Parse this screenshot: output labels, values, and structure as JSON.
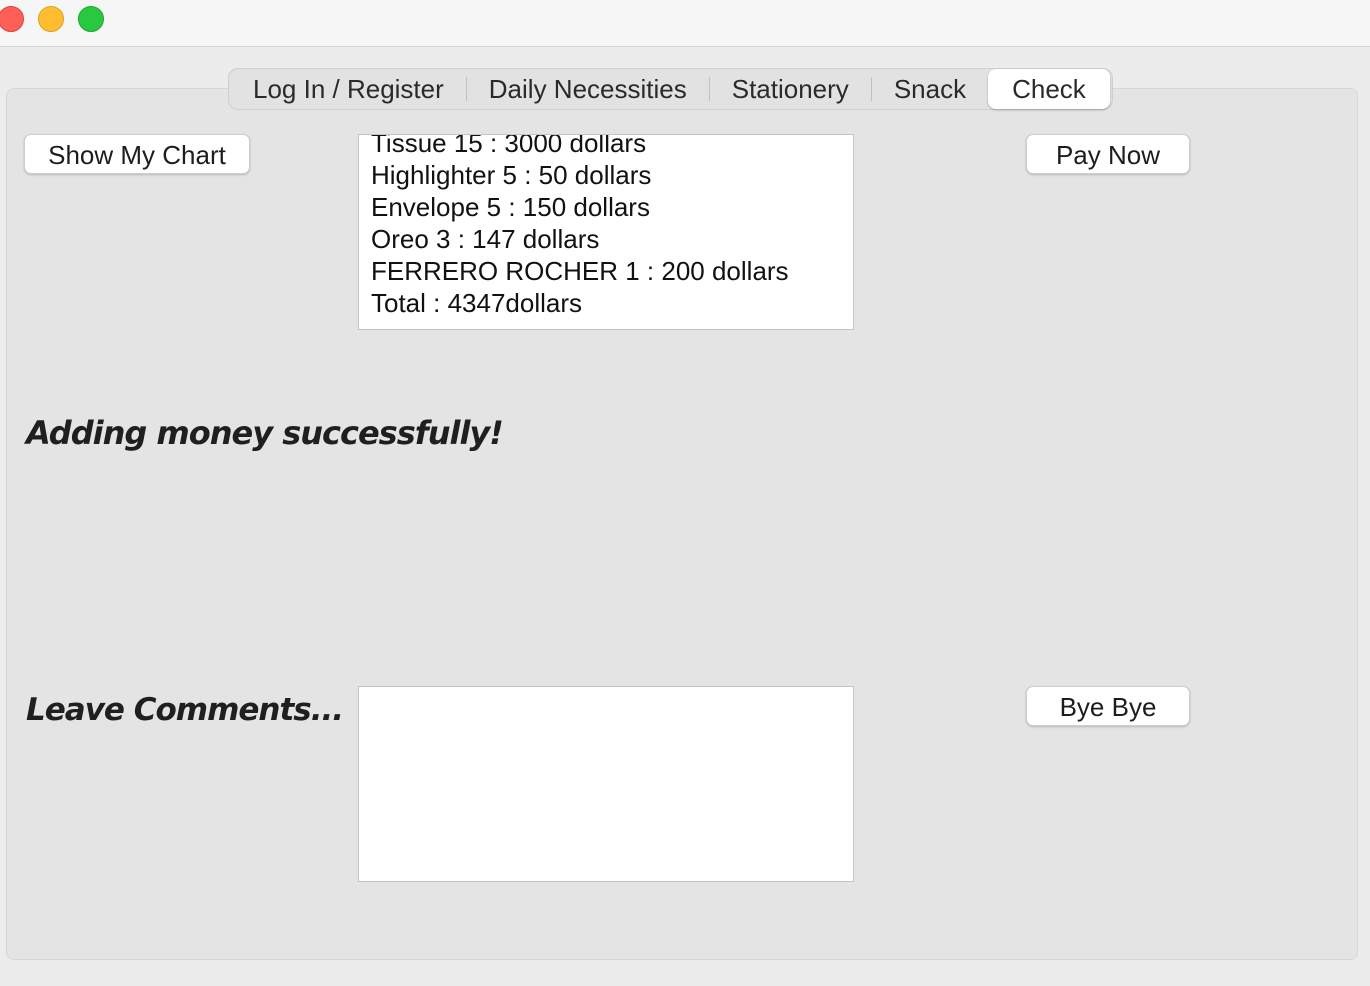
{
  "window": {
    "traffic_lights": [
      "close",
      "minimize",
      "maximize"
    ]
  },
  "tabs": [
    {
      "label": "Log In / Register",
      "active": false
    },
    {
      "label": "Daily Necessities",
      "active": false
    },
    {
      "label": "Stationery",
      "active": false
    },
    {
      "label": "Snack",
      "active": false
    },
    {
      "label": "Check",
      "active": true
    }
  ],
  "buttons": {
    "show_chart": "Show My Chart",
    "pay_now": "Pay Now",
    "bye_bye": "Bye Bye"
  },
  "receipt": {
    "lines": [
      "Tissue 15 : 3000 dollars",
      "Highlighter 5 : 50 dollars",
      "Envelope 5 : 150 dollars",
      "Oreo 3 : 147 dollars",
      "FERRERO ROCHER 1 : 200 dollars",
      "Total : 4347dollars"
    ]
  },
  "status_message": "Adding money successfully!",
  "comments": {
    "label": "Leave Comments...",
    "value": ""
  }
}
